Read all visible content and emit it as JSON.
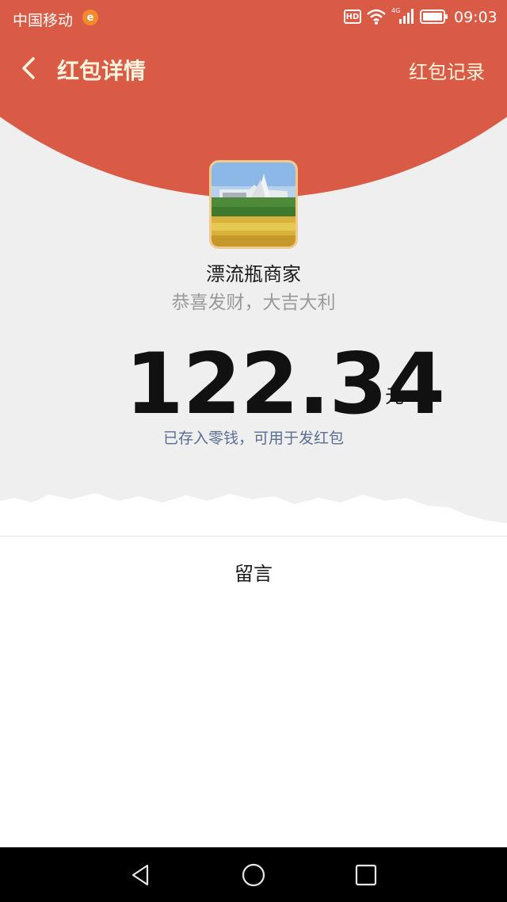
{
  "status_bar": {
    "carrier": "中国移动",
    "carrier_badge": "e",
    "hd_label": "HD",
    "time": "09:03"
  },
  "header": {
    "title": "红包详情",
    "records_link": "红包记录"
  },
  "packet": {
    "sender_name": "漂流瓶商家",
    "greeting": "恭喜发财，大吉大利",
    "amount": "122.34",
    "currency": "元",
    "deposit_note": "已存入零钱，可用于发红包"
  },
  "message_section": {
    "title": "留言"
  },
  "icons": {
    "back": "chevron-left-icon",
    "wifi": "wifi-icon",
    "signal": "signal-4g-icon",
    "battery": "battery-icon",
    "nav_back": "triangle-back-icon",
    "nav_home": "circle-home-icon",
    "nav_recent": "square-recent-icon"
  },
  "colors": {
    "header_red": "#d95b45",
    "header_text": "#fff5df",
    "note_blue": "#5a6e94",
    "avatar_border": "#f0c98e"
  }
}
